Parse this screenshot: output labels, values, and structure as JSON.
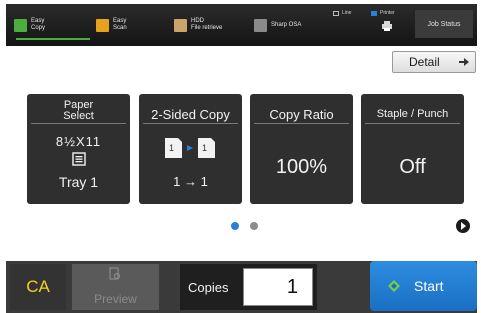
{
  "top_bar": {
    "modes": [
      {
        "label": "Easy\nCopy",
        "icon": "copy-icon"
      },
      {
        "label": "Easy\nScan",
        "icon": "scan-icon"
      },
      {
        "label": "HDD\nFile retrieve",
        "icon": "hdd-icon"
      },
      {
        "label": "Sharp OSA",
        "icon": "osa-icon"
      }
    ],
    "status_line": "Line",
    "printer_label": "Printer",
    "job_status": "Job Status"
  },
  "detail_button": {
    "label": "Detail",
    "icon": "arrow-right-icon"
  },
  "tiles": {
    "paper_select": {
      "title_line1": "Paper",
      "title_line2": "Select",
      "size": "8½X11",
      "tray": "Tray 1",
      "icon": "paper-tray-icon"
    },
    "two_sided": {
      "title": "2-Sided Copy",
      "value": "1 → 1",
      "icon": "duplex-icon"
    },
    "copy_ratio": {
      "title": "Copy Ratio",
      "value": "100%"
    },
    "staple_punch": {
      "title": "Staple / Punch",
      "value": "Off"
    }
  },
  "pagination": {
    "current": 1,
    "total": 2
  },
  "bottom_bar": {
    "ca_label": "CA",
    "preview_label": "Preview",
    "copies_label": "Copies",
    "copies_value": "1",
    "start_label": "Start"
  },
  "colors": {
    "accent_blue": "#2a7fd8",
    "copy_green": "#4cae3e",
    "scan_orange": "#e7a21b",
    "ca_yellow": "#f2d21b"
  }
}
